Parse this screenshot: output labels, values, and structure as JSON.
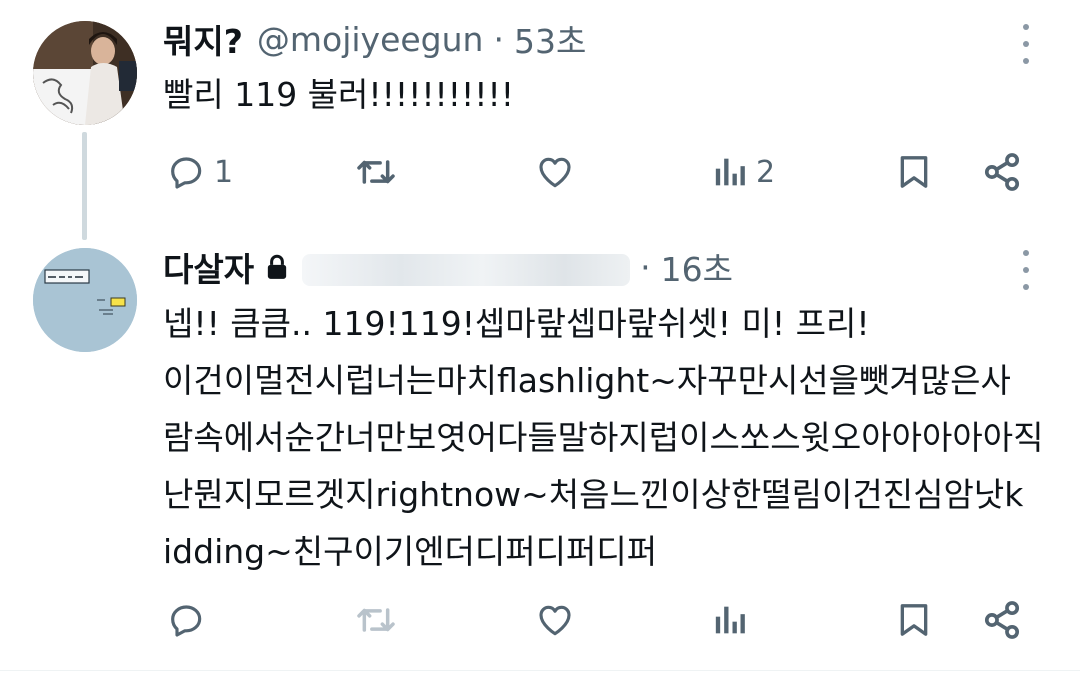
{
  "tweet1": {
    "name": "뭐지?",
    "handle": "@mojiyeegun",
    "separator": "·",
    "time": "53초",
    "text": "빨리 119 불러!!!!!!!!!!!",
    "avatar_icon": "profile-photo-avatar",
    "counts": {
      "reply": "1",
      "retweet": "",
      "like": "",
      "views": "2"
    }
  },
  "tweet2": {
    "name": "다살자",
    "separator": "·",
    "time": "16초",
    "protected_icon": "lock-icon",
    "lines": [
      "넵!! 큼큼.. 119!119!셉마랖셉마랖쉬셋! 미! 프리!",
      "이건이멀전시럽너는마치flashlight~자꾸만시선을뺏겨많은사",
      "람속에서순간너만보엿어다들말하지럽이스쏘스윗오아아아아아직",
      "난뭔지모르겟지rightnow~처음느낀이상한떨림이건진심암낫k",
      "idding~친구이기엔더디퍼디퍼디퍼"
    ],
    "avatar_icon": "drawing-avatar",
    "counts": {
      "reply": "",
      "retweet": "",
      "like": "",
      "views": ""
    }
  },
  "colors": {
    "text": "#0f1419",
    "secondary": "#536471",
    "thread_line": "#cfd9de"
  }
}
